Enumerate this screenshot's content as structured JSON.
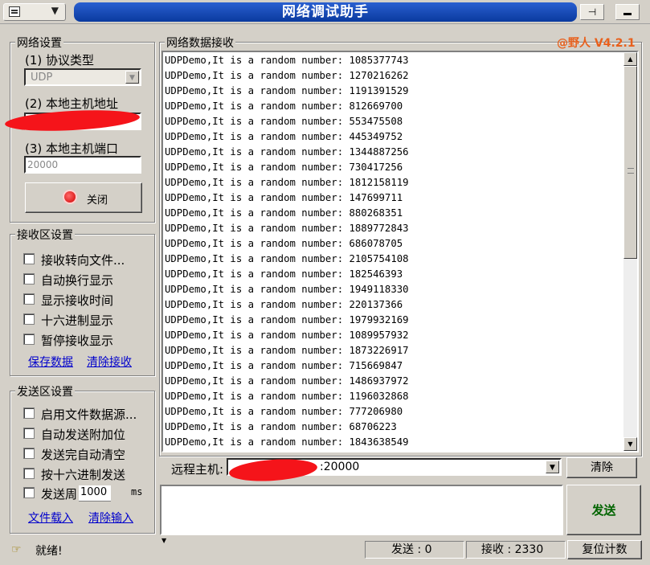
{
  "window": {
    "title": "网络调试助手",
    "version": "@野人 V4.2.1"
  },
  "network_settings": {
    "group_title": "网络设置",
    "protocol_label": "(1) 协议类型",
    "protocol_value": "UDP",
    "local_host_label": "(2) 本地主机地址",
    "local_port_label": "(3) 本地主机端口",
    "local_port_value": "20000",
    "close_button": "关闭"
  },
  "receive_settings": {
    "group_title": "接收区设置",
    "options": [
      "接收转向文件...",
      "自动换行显示",
      "显示接收时间",
      "十六进制显示",
      "暂停接收显示"
    ],
    "save_link": "保存数据",
    "clear_link": "清除接收"
  },
  "send_settings": {
    "group_title": "发送区设置",
    "options": [
      "启用文件数据源...",
      "自动发送附加位",
      "发送完自动清空",
      "按十六进制发送"
    ],
    "period_label": "发送周",
    "period_value": "1000",
    "period_unit": "ms",
    "load_link": "文件载入",
    "clear_link": "清除输入"
  },
  "receive_area": {
    "label": "网络数据接收",
    "lines": [
      "UDPDemo,It is a random number: 1085377743",
      "UDPDemo,It is a random number: 1270216262",
      "UDPDemo,It is a random number: 1191391529",
      "UDPDemo,It is a random number: 812669700",
      "UDPDemo,It is a random number: 553475508",
      "UDPDemo,It is a random number: 445349752",
      "UDPDemo,It is a random number: 1344887256",
      "UDPDemo,It is a random number: 730417256",
      "UDPDemo,It is a random number: 1812158119",
      "UDPDemo,It is a random number: 147699711",
      "UDPDemo,It is a random number: 880268351",
      "UDPDemo,It is a random number: 1889772843",
      "UDPDemo,It is a random number: 686078705",
      "UDPDemo,It is a random number: 2105754108",
      "UDPDemo,It is a random number: 182546393",
      "UDPDemo,It is a random number: 1949118330",
      "UDPDemo,It is a random number: 220137366",
      "UDPDemo,It is a random number: 1979932169",
      "UDPDemo,It is a random number: 1089957932",
      "UDPDemo,It is a random number: 1873226917",
      "UDPDemo,It is a random number: 715669847",
      "UDPDemo,It is a random number: 1486937972",
      "UDPDemo,It is a random number: 1196032868",
      "UDPDemo,It is a random number: 777206980",
      "UDPDemo,It is a random number: 68706223",
      "UDPDemo,It is a random number: 1843638549"
    ]
  },
  "remote": {
    "label": "远程主机:",
    "value": ":20000",
    "clear_button": "清除"
  },
  "send_button": "发送",
  "status": {
    "ready": "就绪!",
    "sent": "发送 : 0",
    "received": "接收 : 2330",
    "reset_button": "复位计数"
  },
  "colors": {
    "title_bar": "#1a4fc0",
    "send_green": "#006400",
    "version_orange": "#e8601c",
    "redaction": "#f5141a"
  }
}
